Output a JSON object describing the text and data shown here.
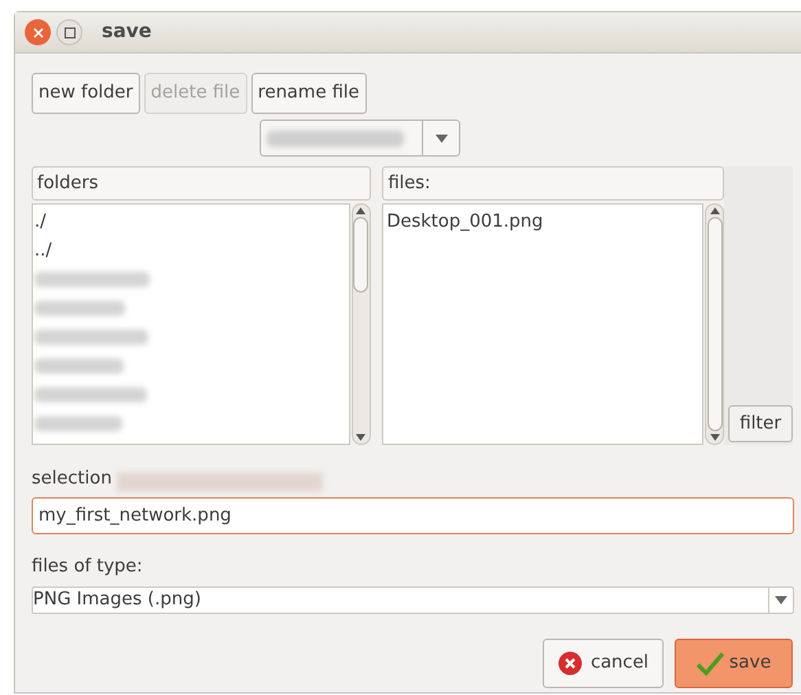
{
  "window": {
    "title": "save"
  },
  "toolbar": [
    {
      "label": "new folder",
      "disabled": false
    },
    {
      "label": "delete file",
      "disabled": true
    },
    {
      "label": "rename file",
      "disabled": false
    }
  ],
  "path_combo": {
    "redacted": true
  },
  "folders": {
    "header": "folders",
    "items": [
      {
        "kind": "text",
        "text": "./"
      },
      {
        "kind": "text",
        "text": "../"
      },
      {
        "kind": "redacted"
      },
      {
        "kind": "redacted"
      },
      {
        "kind": "redacted"
      },
      {
        "kind": "redacted"
      },
      {
        "kind": "redacted"
      },
      {
        "kind": "redacted"
      }
    ]
  },
  "files": {
    "header": "files:",
    "items": [
      "Desktop_001.png"
    ]
  },
  "filter_button": "filter",
  "selection": {
    "label": "selection",
    "path_redacted": true,
    "value": "my_first_network.png"
  },
  "file_type": {
    "label": "files of type:",
    "value": "PNG Images (.png)"
  },
  "buttons": [
    {
      "kind": "cancel",
      "label": "cancel"
    },
    {
      "kind": "save",
      "label": "save"
    }
  ]
}
